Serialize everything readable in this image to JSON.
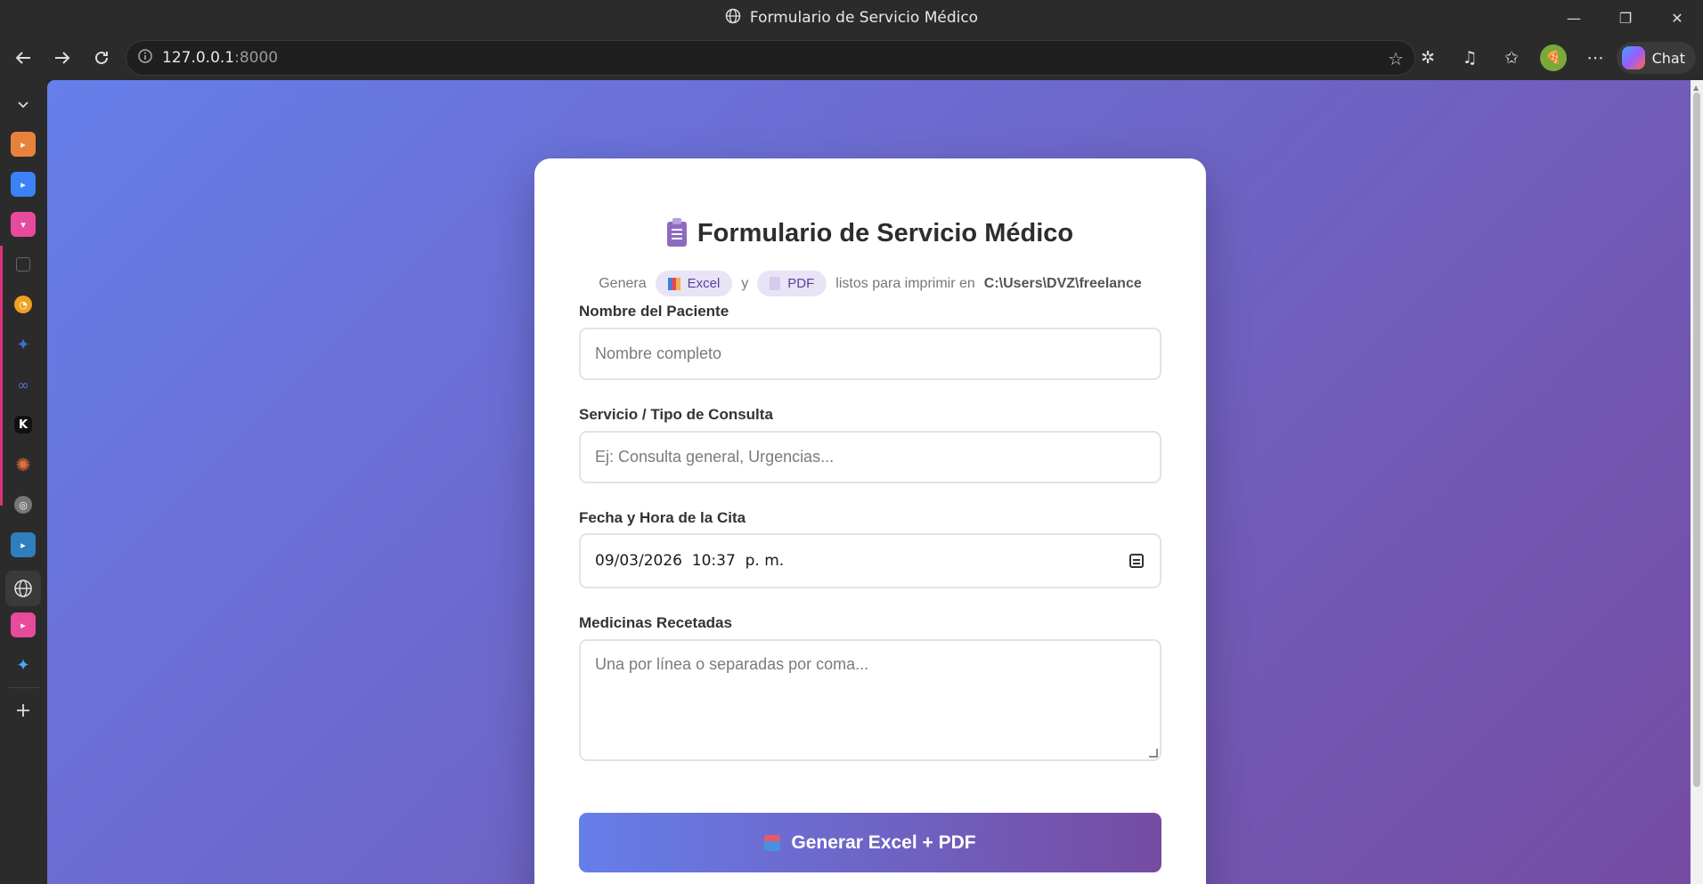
{
  "window": {
    "title": "Formulario de Servicio Médico",
    "controls": [
      "—",
      "❐",
      "✕"
    ]
  },
  "toolbar": {
    "url_host": "127.0.0.1",
    "url_port": ":8000",
    "chat_label": "Chat"
  },
  "sidebar": {
    "items": [
      {
        "icon": "chevron-down-icon",
        "color": "#2b2b2b"
      },
      {
        "icon": "media-app-icon",
        "color": "#e8813a"
      },
      {
        "icon": "media-app-icon",
        "color": "#3b82f6"
      },
      {
        "icon": "media-app-icon",
        "color": "#e84a9c"
      },
      {
        "icon": "app-icon",
        "color": "#444444"
      },
      {
        "icon": "compass-icon",
        "color": "#f0a020"
      },
      {
        "icon": "sparkle-icon",
        "color": "#3b6fd6"
      },
      {
        "icon": "app-icon",
        "color": "#5a6fd6"
      },
      {
        "icon": "k-icon",
        "color": "#111111"
      },
      {
        "icon": "asterisk-icon",
        "color": "#e07040"
      },
      {
        "icon": "app-icon",
        "color": "#777777"
      },
      {
        "icon": "media-app-icon",
        "color": "#2f7fbf"
      },
      {
        "icon": "globe-icon",
        "color": "#3a3a3a"
      },
      {
        "icon": "media-app-icon",
        "color": "#e84a9c"
      },
      {
        "icon": "sparkle-icon",
        "color": "#4aa8ff"
      },
      {
        "icon": "plus-icon",
        "color": "#2b2b2b"
      }
    ]
  },
  "form": {
    "title": "Formulario de Servicio Médico",
    "subtitle_prefix": "Genera",
    "pill_excel": "Excel",
    "subtitle_and": "y",
    "pill_pdf": "PDF",
    "subtitle_mid": "listos para imprimir en",
    "subtitle_path": "C:\\Users\\DVZ\\freelance",
    "patient": {
      "label": "Nombre del Paciente",
      "placeholder": "Nombre completo"
    },
    "service": {
      "label": "Servicio / Tipo de Consulta",
      "placeholder": "Ej: Consulta general, Urgencias..."
    },
    "datetime": {
      "label": "Fecha y Hora de la Cita",
      "value": "09/03/2026  10:37  p. m."
    },
    "medicines": {
      "label": "Medicinas Recetadas",
      "placeholder": "Una por línea o separadas por coma..."
    },
    "submit_label": "Generar Excel + PDF"
  },
  "colors": {
    "gradient_start": "#667eea",
    "gradient_end": "#764ba2"
  }
}
